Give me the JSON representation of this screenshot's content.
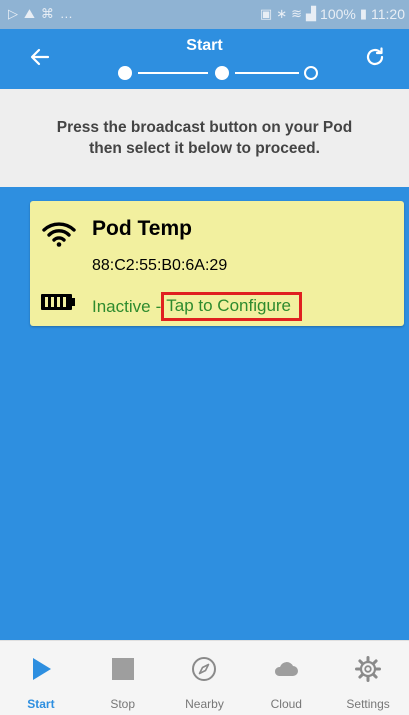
{
  "status_bar": {
    "battery_percent": "100%",
    "time": "11:20"
  },
  "app_bar": {
    "title": "Start",
    "steps": [
      {
        "state": "complete"
      },
      {
        "state": "complete"
      },
      {
        "state": "pending"
      }
    ]
  },
  "instructions": {
    "line1": "Press the broadcast button on your Pod",
    "line2": "then select it below to proceed."
  },
  "device": {
    "name": "Pod Temp",
    "mac": "88:C2:55:B0:6A:29",
    "status": "Inactive",
    "separator": "-",
    "action_label": "Tap to Configure"
  },
  "bottom_nav": {
    "items": [
      {
        "label": "Start",
        "icon": "play-icon",
        "active": true
      },
      {
        "label": "Stop",
        "icon": "stop-icon",
        "active": false
      },
      {
        "label": "Nearby",
        "icon": "compass-icon",
        "active": false
      },
      {
        "label": "Cloud",
        "icon": "cloud-icon",
        "active": false
      },
      {
        "label": "Settings",
        "icon": "gear-icon",
        "active": false
      }
    ]
  },
  "colors": {
    "primary": "#2e8fe0",
    "card": "#f2f09f",
    "status_green": "#2e8b2e",
    "highlight_red": "#e02020"
  }
}
